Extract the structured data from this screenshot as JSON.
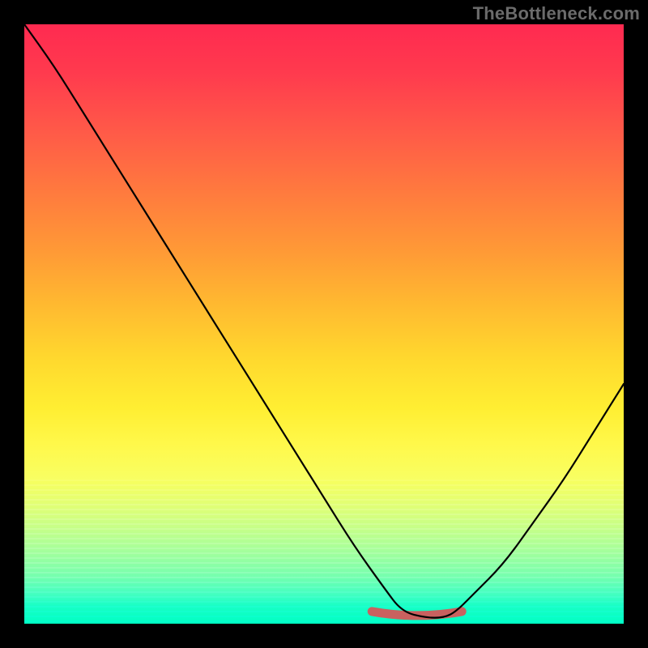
{
  "watermark": "TheBottleneck.com",
  "colors": {
    "background": "#000000",
    "watermark_text": "#6b6b6b",
    "curve_stroke": "#000000",
    "valley_marker": "#c9615f",
    "gradient_top": "#ff2a50",
    "gradient_bottom": "#00ffc6"
  },
  "chart_data": {
    "type": "line",
    "title": "",
    "xlabel": "",
    "ylabel": "",
    "xlim": [
      0,
      100
    ],
    "ylim": [
      0,
      100
    ],
    "grid": false,
    "series": [
      {
        "name": "bottleneck-curve",
        "x": [
          0,
          5,
          10,
          15,
          20,
          25,
          30,
          35,
          40,
          45,
          50,
          55,
          60,
          63,
          67,
          70,
          72,
          75,
          80,
          85,
          90,
          95,
          100
        ],
        "values": [
          100,
          93,
          85,
          77,
          69,
          61,
          53,
          45,
          37,
          29,
          21,
          13,
          6,
          2,
          1,
          1,
          2,
          5,
          10,
          17,
          24,
          32,
          40
        ]
      }
    ],
    "valley_marker": {
      "x_start": 58,
      "x_end": 73,
      "y": 1.5
    },
    "background_gradient": {
      "direction": "top-to-bottom",
      "meaning": "red=high bottleneck, green=low bottleneck"
    }
  }
}
